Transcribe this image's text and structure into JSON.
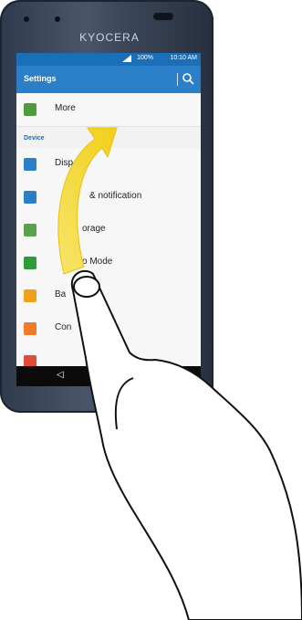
{
  "phone": {
    "brand": "KYOCERA"
  },
  "status_bar": {
    "battery": "100%",
    "time": "10:10 AM"
  },
  "app_bar": {
    "title": "Settings"
  },
  "settings": {
    "more_label": "More",
    "section_header": "Device",
    "items": [
      {
        "label": "Disp",
        "icon": "display-icon",
        "color": "#2b7fc9"
      },
      {
        "label": "& notification",
        "icon": "sound-icon",
        "color": "#2b7fc9"
      },
      {
        "label": "orage",
        "icon": "storage-icon",
        "color": "#56a14a"
      },
      {
        "label": "o Mode",
        "icon": "eco-mode-icon",
        "color": "#2f9a3a"
      },
      {
        "label": "Ba",
        "icon": "battery-icon",
        "color": "#f1a01b"
      },
      {
        "label": "Con",
        "icon": "connection-icon",
        "color": "#f07a2c"
      }
    ]
  },
  "colors": {
    "accent": "#2b7fc9",
    "status_bar": "#1b6fb8",
    "arrow": "#f5d21e"
  },
  "gesture": "swipe-up"
}
